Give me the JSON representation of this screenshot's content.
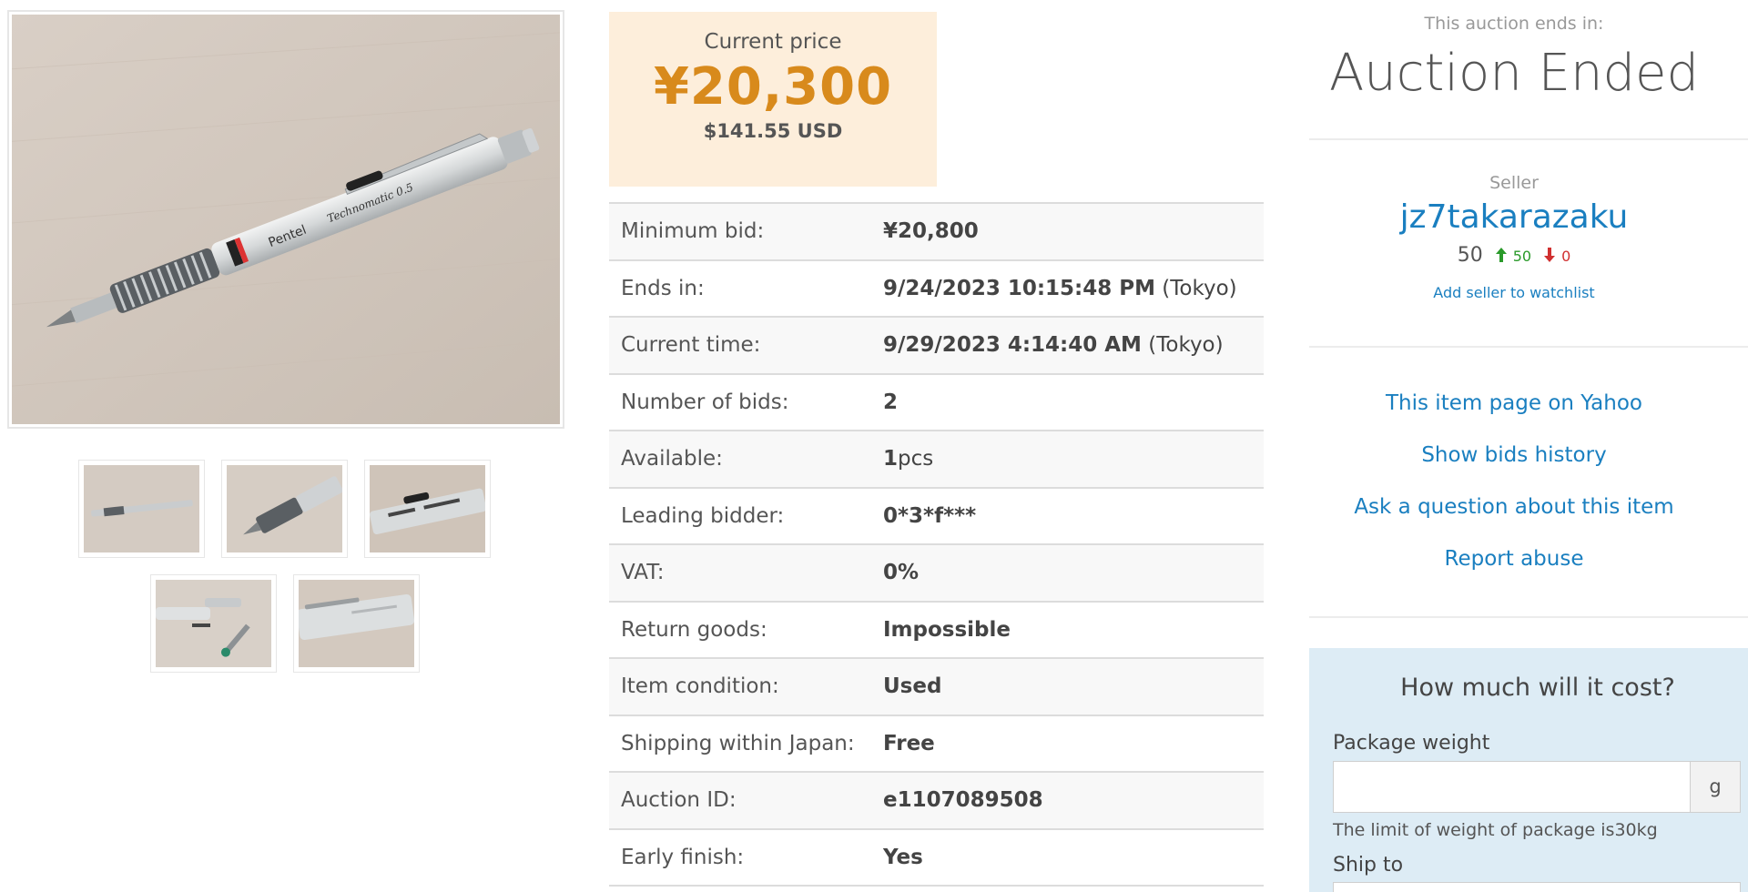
{
  "price": {
    "label": "Current price",
    "value": "¥20,300",
    "usd": "$141.55 USD",
    "accent_color": "#d88a1c",
    "box_color": "#fdeedb"
  },
  "details": {
    "rows": [
      {
        "label": "Minimum bid:",
        "value": "¥20,800",
        "suffix": ""
      },
      {
        "label": "Ends in:",
        "value": "9/24/2023 10:15:48 PM",
        "suffix": " (Tokyo)"
      },
      {
        "label": "Current time:",
        "value": "9/29/2023 4:14:40 AM",
        "suffix": " (Tokyo)"
      },
      {
        "label": "Number of bids:",
        "value": "2",
        "suffix": ""
      },
      {
        "label": "Available:",
        "value": "1",
        "suffix": "pcs"
      },
      {
        "label": "Leading bidder:",
        "value": "0*3*f***",
        "suffix": ""
      },
      {
        "label": "VAT:",
        "value": "0%",
        "suffix": ""
      },
      {
        "label": "Return goods:",
        "value": "Impossible",
        "suffix": ""
      },
      {
        "label": "Item condition:",
        "value": "Used",
        "suffix": ""
      },
      {
        "label": "Shipping within Japan:",
        "value": "Free",
        "suffix": ""
      },
      {
        "label": "Auction ID:",
        "value": "e1107089508",
        "suffix": ""
      },
      {
        "label": "Early finish:",
        "value": "Yes",
        "suffix": ""
      }
    ]
  },
  "auction": {
    "ends_label": "This auction ends in:",
    "status": "Auction Ended"
  },
  "seller": {
    "label": "Seller",
    "name": "jz7takarazaku",
    "rating": "50",
    "positive": "50",
    "negative": "0",
    "watchlist_link": "Add seller to watchlist",
    "link_color": "#1a7fc0"
  },
  "links": {
    "yahoo": "This item page on Yahoo",
    "bids_history": "Show bids history",
    "ask_question": "Ask a question about this item",
    "report": "Report abuse"
  },
  "cost": {
    "title": "How much will it cost?",
    "weight_label": "Package weight",
    "weight_value": "",
    "weight_unit": "g",
    "limit_text": "The limit of weight of package is30kg",
    "ship_label": "Ship to"
  },
  "gallery": {
    "main_image": "pentel-technomatic-pencil-photo",
    "thumbnails": [
      "thumb-1",
      "thumb-2",
      "thumb-3",
      "thumb-4",
      "thumb-5"
    ],
    "pencil_text": [
      "Pentel",
      "Technomatic 0.5"
    ]
  }
}
